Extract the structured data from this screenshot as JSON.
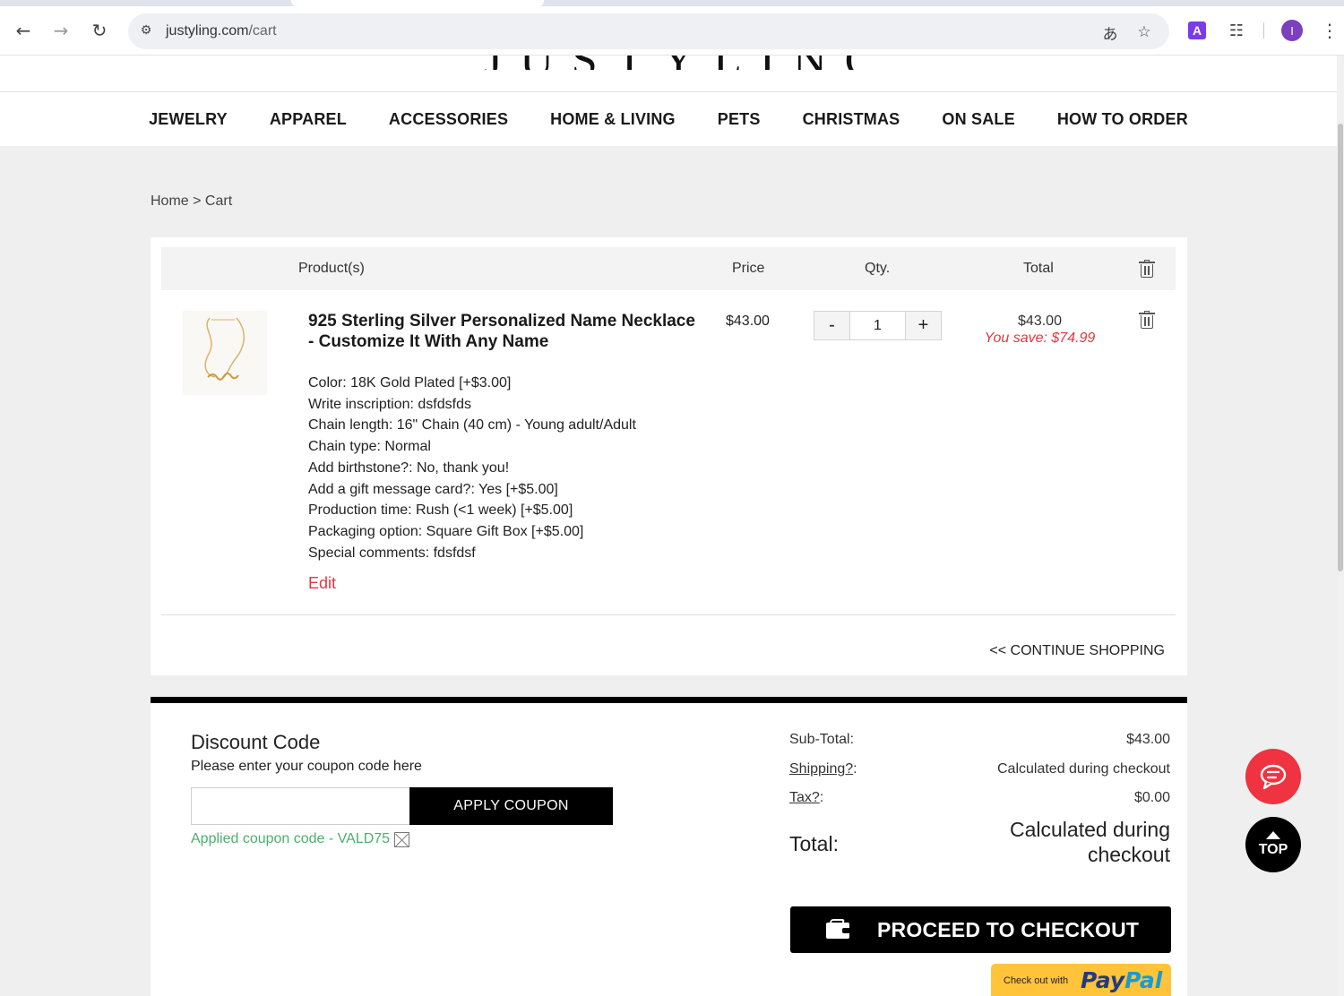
{
  "browser": {
    "url_domain": "justyling.com",
    "url_path": "/cart",
    "profile_initial": "I",
    "extension_letter": "A"
  },
  "site": {
    "logo_text": "JUSTYLING",
    "nav": [
      "JEWELRY",
      "APPAREL",
      "ACCESSORIES",
      "HOME & LIVING",
      "PETS",
      "CHRISTMAS",
      "ON SALE",
      "HOW TO ORDER"
    ]
  },
  "breadcrumb": "Home > Cart",
  "cart": {
    "headers": {
      "product": "Product(s)",
      "price": "Price",
      "qty": "Qty.",
      "total": "Total"
    },
    "item": {
      "title": "925 Sterling Silver Personalized Name Necklace - Customize It With Any Name",
      "price": "$43.00",
      "quantity": "1",
      "qty_minus": "-",
      "qty_plus": "+",
      "line_total": "$43.00",
      "you_save": "You save: $74.99",
      "options": [
        "Color: 18K Gold Plated [+$3.00]",
        "Write inscription: dsfdsfds",
        "Chain length: 16\" Chain (40 cm) - Young adult/Adult",
        "Chain type: Normal",
        "Add birthstone?: No, thank you!",
        "Add a gift message card?: Yes [+$5.00]",
        "Production time: Rush (<1 week) [+$5.00]",
        "Packaging option: Square Gift Box [+$5.00]",
        "Special comments: fdsfdsf"
      ],
      "edit_label": "Edit"
    },
    "continue_shopping": "<< CONTINUE SHOPPING"
  },
  "discount": {
    "title": "Discount Code",
    "hint": "Please enter your coupon code here",
    "input_value": "",
    "apply_label": "APPLY COUPON",
    "applied_text": "Applied coupon code - VALD75"
  },
  "summary": {
    "subtotal_label": "Sub-Total:",
    "subtotal_value": "$43.00",
    "shipping_label": "Shipping?",
    "shipping_colon": ":",
    "shipping_value": "Calculated during checkout",
    "tax_label": "Tax?",
    "tax_colon": ":",
    "tax_value": "$0.00",
    "total_label": "Total:",
    "total_value": "Calculated during checkout"
  },
  "checkout": {
    "proceed_label": "PROCEED TO CHECKOUT",
    "paypal_small": "Check out with",
    "paypal_pay": "Pay",
    "paypal_pal": "Pal"
  },
  "floating": {
    "top_label": "TOP"
  },
  "colors": {
    "accent_red": "#e0393e",
    "coupon_green": "#4caf6e",
    "paypal_yellow": "#ffc439"
  }
}
